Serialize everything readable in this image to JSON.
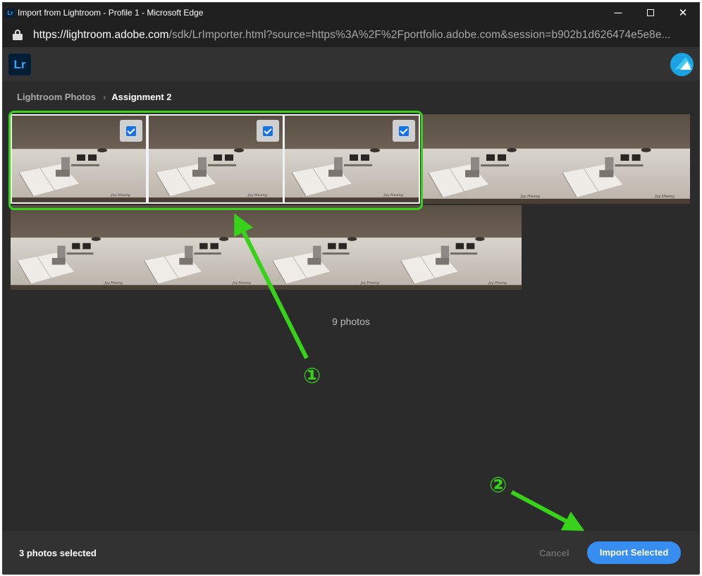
{
  "window": {
    "title": "Import from Lightroom - Profile 1 - Microsoft Edge",
    "favicon_text": "Lr",
    "controls": {
      "minimize": "─",
      "close": "✕"
    }
  },
  "address_bar": {
    "url_host": "https://lightroom.adobe.com",
    "url_path": "/sdk/LrImporter.html?source=https%3A%2F%2Fportfolio.adobe.com&session=b902b1d626474e5e8e..."
  },
  "app_header": {
    "logo_text": "Lr",
    "avatar_icon": "user-avatar-icon"
  },
  "breadcrumb": {
    "root": "Lightroom Photos",
    "separator": "›",
    "current": "Assignment 2"
  },
  "photos": [
    {
      "selected": true,
      "watermark": "Jay Hwang"
    },
    {
      "selected": true,
      "watermark": "Jay Hwang"
    },
    {
      "selected": true,
      "watermark": "Jay Hwang"
    },
    {
      "selected": false,
      "watermark": "Jay Hwang"
    },
    {
      "selected": false,
      "watermark": "Jay Hwang"
    },
    {
      "selected": false,
      "watermark": "Jay Hwang"
    },
    {
      "selected": false,
      "watermark": "Jay Hwang"
    },
    {
      "selected": false,
      "watermark": "Jay Hwang"
    },
    {
      "selected": false,
      "watermark": "Jay Hwang"
    }
  ],
  "photo_count_label": "9 photos",
  "footer": {
    "selection_status": "3 photos selected",
    "cancel_label": "Cancel",
    "import_label": "Import Selected"
  },
  "annotations": {
    "step1": "①",
    "step2": "②",
    "color": "#39d21b"
  },
  "colors": {
    "accent": "#378ef0",
    "checkbox": "#1473e6",
    "background": "#2b2b2b"
  }
}
